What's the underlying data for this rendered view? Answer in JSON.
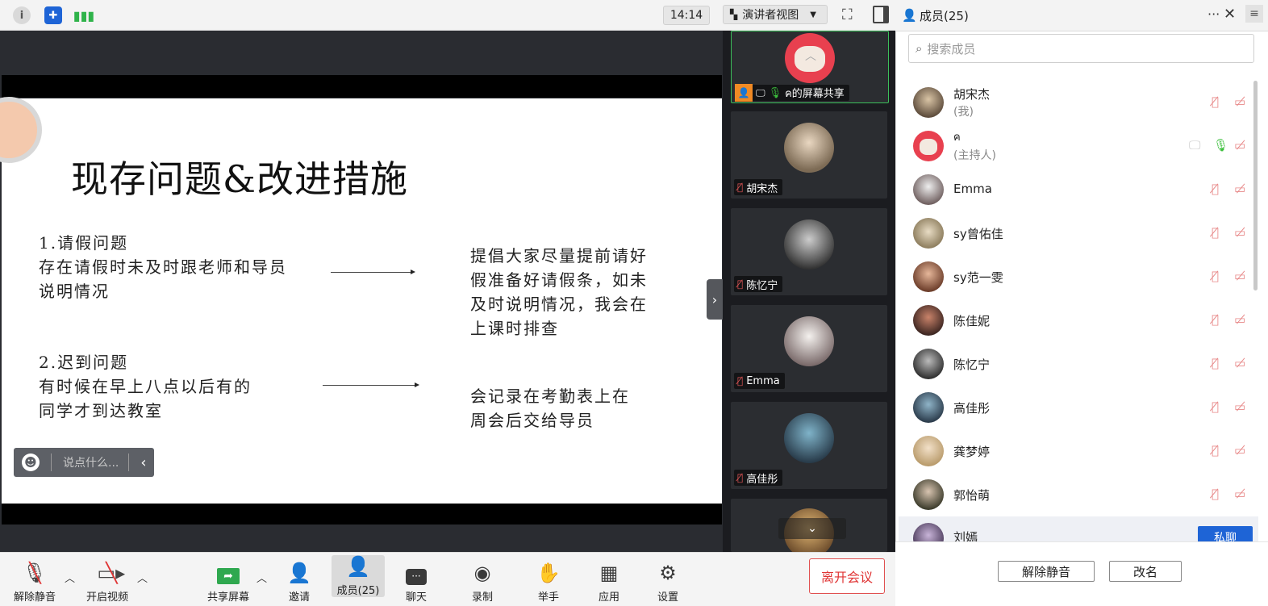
{
  "topbar": {
    "info_icon": "info-icon",
    "shield_icon": "shield-icon",
    "signal_icon": "signal-bars-icon",
    "time": "14:14",
    "view_mode": "演讲者视图",
    "fullscreen_icon": "fullscreen-icon",
    "layout_icon": "sidebar-layout-icon"
  },
  "slide": {
    "title": "现存问题&改进措施",
    "issue1_title": "1.请假问题",
    "issue1_line1": "存在请假时未及时跟老师和导员",
    "issue1_line2": "说明情况",
    "measure1_line1": "提倡大家尽量提前请好",
    "measure1_line2": "假准备好请假条，如未",
    "measure1_line3": "及时说明情况，我会在",
    "measure1_line4": "上课时排查",
    "issue2_title": "2.迟到问题",
    "issue2_line1": "有时候在早上八点以后有的",
    "issue2_line2": "同学才到达教室",
    "measure2_line1": "会记录在考勤表上在",
    "measure2_line2": "周会后交给导员"
  },
  "chat_bubble": {
    "placeholder": "说点什么..."
  },
  "video_tiles": [
    {
      "name": "ค的屏幕共享"
    },
    {
      "name": "胡宋杰"
    },
    {
      "name": "陈忆宁"
    },
    {
      "name": "Emma"
    },
    {
      "name": "高佳彤"
    }
  ],
  "toolbar": {
    "unmute": "解除静音",
    "start_video": "开启视频",
    "share_screen": "共享屏幕",
    "invite": "邀请",
    "members": "成员(25)",
    "chat": "聊天",
    "record": "录制",
    "raise_hand": "举手",
    "apps": "应用",
    "settings": "设置",
    "leave": "离开会议"
  },
  "panel": {
    "title": "成员(25)",
    "search_placeholder": "搜索成员",
    "members": [
      {
        "name": "胡宋杰",
        "role": "(我)"
      },
      {
        "name": "ค",
        "role": "(主持人)"
      },
      {
        "name": "Emma"
      },
      {
        "name": "sy曾佑佳"
      },
      {
        "name": "sy范一雯"
      },
      {
        "name": "陈佳妮"
      },
      {
        "name": "陈忆宁"
      },
      {
        "name": "高佳彤"
      },
      {
        "name": "龚梦婷"
      },
      {
        "name": "郭怡萌"
      },
      {
        "name": "刘嫣"
      }
    ],
    "private_chat": "私聊",
    "unmute_button": "解除静音",
    "rename_button": "改名"
  },
  "colors": {
    "accent_blue": "#1e64d6",
    "leave_red": "#e03535",
    "mic_on_green": "#3cbf3c",
    "mic_off_red": "#e88a8a"
  }
}
